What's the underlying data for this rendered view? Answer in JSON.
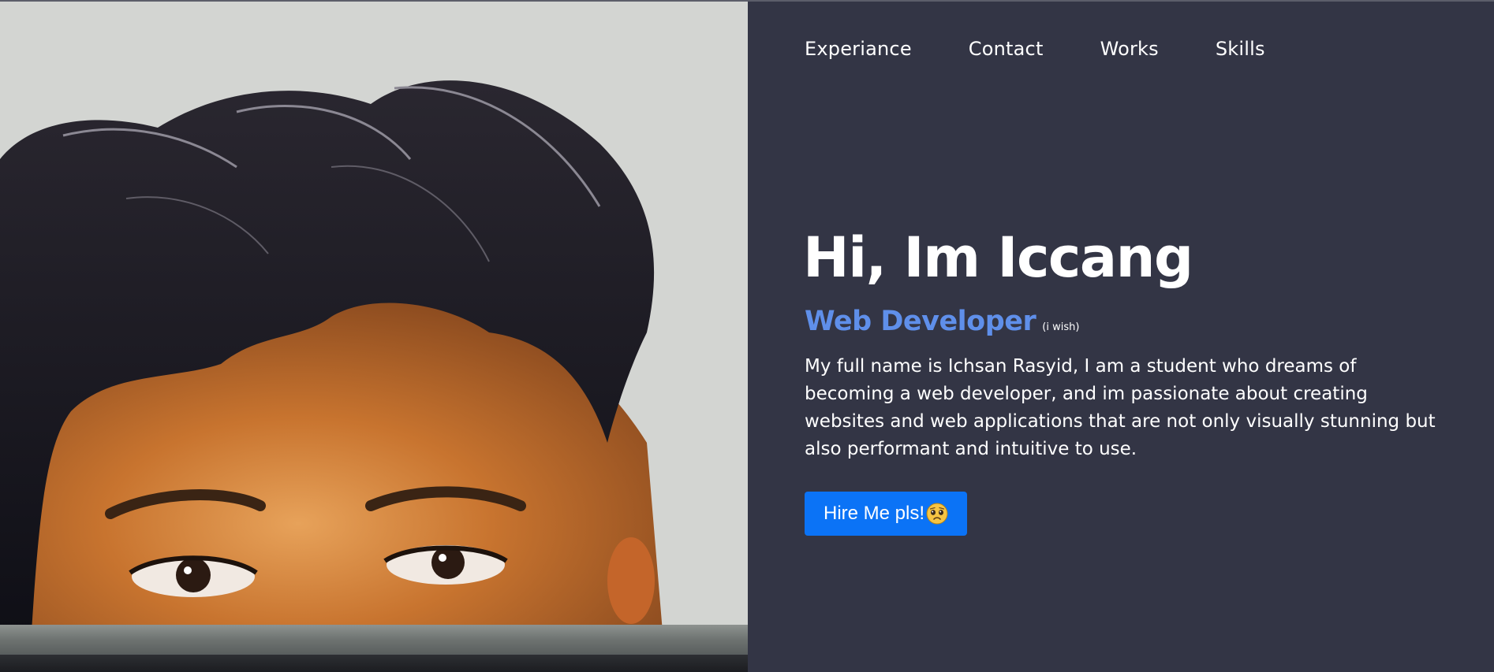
{
  "nav": {
    "items": [
      {
        "label": "Experiance"
      },
      {
        "label": "Contact"
      },
      {
        "label": "Works"
      },
      {
        "label": "Skills"
      }
    ]
  },
  "hero": {
    "title": "Hi, Im Iccang",
    "role": "Web Developer",
    "role_note": "(i wish)",
    "bio": "My full name is Ichsan Rasyid, I am a student who dreams of becoming a web developer, and im passionate about creating websites and web applications that are not only visually stunning but also performant and intuitive to use.",
    "cta_label": "Hire Me pls!",
    "cta_icon": "pleading-face-icon"
  },
  "colors": {
    "background": "#333545",
    "accent": "#5f8fea",
    "button": "#0b73f6",
    "text": "#ffffff"
  }
}
